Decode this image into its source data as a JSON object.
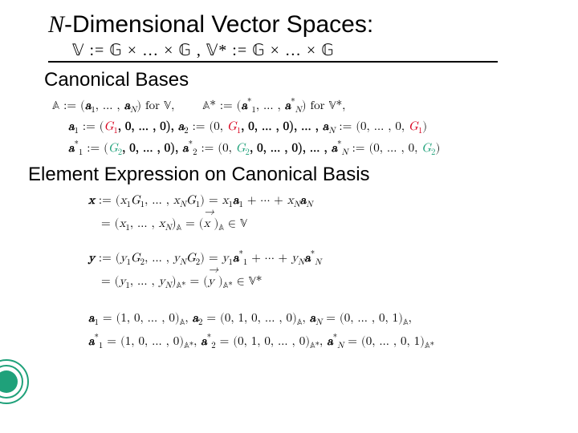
{
  "title_prefix": "N",
  "title_rest": "-Dimensional Vector Spaces:",
  "subdef": "𝕍 := 𝔾  × … × 𝔾  ,  𝕍* := 𝔾  × … × 𝔾  ",
  "section1": "Canonical Bases",
  "canon_line1_a": "𝔸 := (",
  "canon_line1_b": ", … , ",
  "canon_line1_c": ") for 𝕍,",
  "canon_line1_d": "𝔸* := (",
  "canon_line1_e": ", … , ",
  "canon_line1_f": ") for 𝕍*,",
  "a1": "a",
  "sub1": "1",
  "aN": "a",
  "subN": "N",
  "as1": "a",
  "asN": "a",
  "star": "*",
  "canon_line2_a1": " := (",
  "canon_line2_g1": "G",
  "canon_line2_a2": ", 0, … , 0), ",
  "canon_line2_b1": " := (0, ",
  "canon_line2_b2": ", 0, … , 0), … , ",
  "canon_line2_c1": " := (0, … , 0, ",
  "canon_line2_c2": ")",
  "sub2": "2",
  "section2": "Element Expression on Canonical Basis",
  "x_def1a": "x",
  "x_def1b": " := (",
  "x_def1c": "x",
  "x_def1d": "G",
  "x_def1e": ", … , ",
  "x_def1f": "x",
  "x_def1g": "G",
  "x_def1h": ") = ",
  "x_def1i": "x",
  "x_def1j": " + ⋯ + ",
  "x_def1k": "x",
  "x_line2a": "= (",
  "x_line2b": "x",
  "x_line2c": ", … , ",
  "x_line2d": "x",
  "x_line2e": ")",
  "x_line2f": " = (",
  "x_line2g": "x",
  "x_line2h": ")",
  "in": " ∈ 𝕍",
  "y_def1a": "y",
  "y_def1b": " := (",
  "y_def1c": "y",
  "y_def1d": "G",
  "y_def1e": ", … , ",
  "y_def1f": "y",
  "y_def1g": "G",
  "y_def1h": ") = ",
  "y_def1i": "y",
  "y_def1j": " + ⋯ + ",
  "y_def1k": "y",
  "y_line2a": "= (",
  "y_line2b": "y",
  "y_line2c": ", … , ",
  "y_line2d": "y",
  "y_line2e": ")",
  "y_line2f": " = (",
  "y_line2g": "y",
  "y_line2h": ")",
  "in2": " ∈ 𝕍*",
  "botA1": " = (1, 0, … , 0)",
  "botA2": " = (0, 1, 0, … , 0)",
  "botAN": " = (0, … , 0, 1)",
  "comma": ", ",
  "Asub": "𝔸",
  "Asubstar": "𝔸*"
}
